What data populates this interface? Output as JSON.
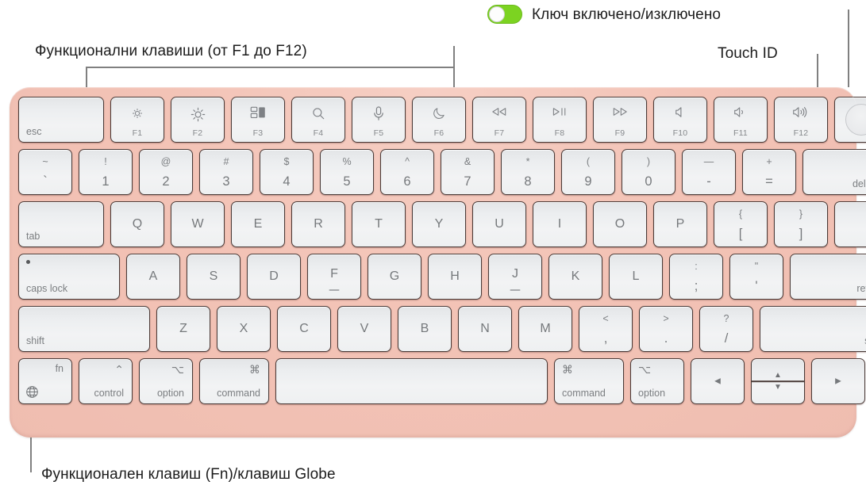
{
  "document": {
    "subject": "Magic Keyboard with Touch ID diagram",
    "language": "bg"
  },
  "callouts": {
    "function_keys": "Функционални клавиши (от F1 до F12)",
    "power_toggle": "Ключ включено/изключено",
    "touch_id": "Touch ID",
    "fn_globe": "Функционален клавиш (Fn)/клавиш Globe"
  },
  "toggle": {
    "state": "on",
    "track_color": "#7cd321",
    "knob_color": "#fdfdfd"
  },
  "colors": {
    "keyboard_body": "#f1c0b3",
    "key_face": "#eef0f1",
    "key_border": "#4a3b38",
    "key_text": "#76797c",
    "leader_line": "#808080",
    "label_text": "#1c1c1c"
  },
  "keyboard": {
    "rows": [
      {
        "name": "function-row",
        "keys": [
          {
            "name": "esc",
            "style": "corner-label",
            "label": "esc"
          },
          {
            "name": "f1",
            "style": "fn",
            "icon": "brightness-down-icon",
            "fkey": "F1"
          },
          {
            "name": "f2",
            "style": "fn",
            "icon": "brightness-up-icon",
            "fkey": "F2"
          },
          {
            "name": "f3",
            "style": "fn",
            "icon": "mission-control-icon",
            "fkey": "F3"
          },
          {
            "name": "f4",
            "style": "fn",
            "icon": "spotlight-search-icon",
            "fkey": "F4"
          },
          {
            "name": "f5",
            "style": "fn",
            "icon": "dictation-mic-icon",
            "fkey": "F5"
          },
          {
            "name": "f6",
            "style": "fn",
            "icon": "do-not-disturb-moon-icon",
            "fkey": "F6"
          },
          {
            "name": "f7",
            "style": "fn",
            "icon": "rewind-icon",
            "fkey": "F7"
          },
          {
            "name": "f8",
            "style": "fn",
            "icon": "play-pause-icon",
            "fkey": "F8"
          },
          {
            "name": "f9",
            "style": "fn",
            "icon": "fast-forward-icon",
            "fkey": "F9"
          },
          {
            "name": "f10",
            "style": "fn",
            "icon": "volume-mute-icon",
            "fkey": "F10"
          },
          {
            "name": "f11",
            "style": "fn",
            "icon": "volume-down-icon",
            "fkey": "F11"
          },
          {
            "name": "f12",
            "style": "fn",
            "icon": "volume-up-icon",
            "fkey": "F12"
          },
          {
            "name": "touch-id",
            "style": "touchid",
            "icon": "touch-id-icon"
          }
        ]
      },
      {
        "name": "number-row",
        "keys": [
          {
            "name": "backtick",
            "style": "dual",
            "upper": "~",
            "lower": "`"
          },
          {
            "name": "digit-1",
            "style": "dual",
            "upper": "!",
            "lower": "1"
          },
          {
            "name": "digit-2",
            "style": "dual",
            "upper": "@",
            "lower": "2"
          },
          {
            "name": "digit-3",
            "style": "dual",
            "upper": "#",
            "lower": "3"
          },
          {
            "name": "digit-4",
            "style": "dual",
            "upper": "$",
            "lower": "4"
          },
          {
            "name": "digit-5",
            "style": "dual",
            "upper": "%",
            "lower": "5"
          },
          {
            "name": "digit-6",
            "style": "dual",
            "upper": "^",
            "lower": "6"
          },
          {
            "name": "digit-7",
            "style": "dual",
            "upper": "&",
            "lower": "7"
          },
          {
            "name": "digit-8",
            "style": "dual",
            "upper": "*",
            "lower": "8"
          },
          {
            "name": "digit-9",
            "style": "dual",
            "upper": "(",
            "lower": "9"
          },
          {
            "name": "digit-0",
            "style": "dual",
            "upper": ")",
            "lower": "0"
          },
          {
            "name": "minus",
            "style": "dual",
            "upper": "—",
            "lower": "-"
          },
          {
            "name": "equals",
            "style": "dual",
            "upper": "+",
            "lower": "="
          },
          {
            "name": "delete",
            "style": "corner-label-right",
            "label": "delete"
          }
        ]
      },
      {
        "name": "qwerty-row",
        "keys": [
          {
            "name": "tab",
            "style": "corner-label",
            "label": "tab"
          },
          {
            "name": "key-q",
            "style": "letter",
            "label": "Q"
          },
          {
            "name": "key-w",
            "style": "letter",
            "label": "W"
          },
          {
            "name": "key-e",
            "style": "letter",
            "label": "E"
          },
          {
            "name": "key-r",
            "style": "letter",
            "label": "R"
          },
          {
            "name": "key-t",
            "style": "letter",
            "label": "T"
          },
          {
            "name": "key-y",
            "style": "letter",
            "label": "Y"
          },
          {
            "name": "key-u",
            "style": "letter",
            "label": "U"
          },
          {
            "name": "key-i",
            "style": "letter",
            "label": "I"
          },
          {
            "name": "key-o",
            "style": "letter",
            "label": "O"
          },
          {
            "name": "key-p",
            "style": "letter",
            "label": "P"
          },
          {
            "name": "bracket-left",
            "style": "dual",
            "upper": "{",
            "lower": "["
          },
          {
            "name": "bracket-right",
            "style": "dual",
            "upper": "}",
            "lower": "]"
          },
          {
            "name": "backslash",
            "style": "dual",
            "upper": "|",
            "lower": "\\"
          }
        ]
      },
      {
        "name": "home-row",
        "keys": [
          {
            "name": "caps-lock",
            "style": "capslock",
            "label": "caps lock"
          },
          {
            "name": "key-a",
            "style": "letter",
            "label": "A"
          },
          {
            "name": "key-s",
            "style": "letter",
            "label": "S"
          },
          {
            "name": "key-d",
            "style": "letter",
            "label": "D"
          },
          {
            "name": "key-f",
            "style": "letter",
            "label": "F",
            "homing": true
          },
          {
            "name": "key-g",
            "style": "letter",
            "label": "G"
          },
          {
            "name": "key-h",
            "style": "letter",
            "label": "H"
          },
          {
            "name": "key-j",
            "style": "letter",
            "label": "J",
            "homing": true
          },
          {
            "name": "key-k",
            "style": "letter",
            "label": "K"
          },
          {
            "name": "key-l",
            "style": "letter",
            "label": "L"
          },
          {
            "name": "semicolon",
            "style": "dual",
            "upper": ":",
            "lower": ";"
          },
          {
            "name": "quote",
            "style": "dual",
            "upper": "\"",
            "lower": "'"
          },
          {
            "name": "return",
            "style": "corner-label-right",
            "label": "return"
          }
        ]
      },
      {
        "name": "shift-row",
        "keys": [
          {
            "name": "shift-left",
            "style": "corner-label",
            "label": "shift"
          },
          {
            "name": "key-z",
            "style": "letter",
            "label": "Z"
          },
          {
            "name": "key-x",
            "style": "letter",
            "label": "X"
          },
          {
            "name": "key-c",
            "style": "letter",
            "label": "C"
          },
          {
            "name": "key-v",
            "style": "letter",
            "label": "V"
          },
          {
            "name": "key-b",
            "style": "letter",
            "label": "B"
          },
          {
            "name": "key-n",
            "style": "letter",
            "label": "N"
          },
          {
            "name": "key-m",
            "style": "letter",
            "label": "M"
          },
          {
            "name": "comma",
            "style": "dual",
            "upper": "<",
            "lower": ","
          },
          {
            "name": "period",
            "style": "dual",
            "upper": ">",
            "lower": "."
          },
          {
            "name": "slash",
            "style": "dual",
            "upper": "?",
            "lower": "/"
          },
          {
            "name": "shift-right",
            "style": "corner-label-right",
            "label": "shift"
          }
        ]
      },
      {
        "name": "bottom-row",
        "keys": [
          {
            "name": "fn-globe",
            "style": "fnglobe",
            "label": "fn",
            "icon": "globe-icon"
          },
          {
            "name": "control",
            "style": "mod-right",
            "symbol": "⌃",
            "label": "control"
          },
          {
            "name": "option-left",
            "style": "mod-right",
            "symbol": "⌥",
            "label": "option"
          },
          {
            "name": "command-left",
            "style": "mod-right",
            "symbol": "⌘",
            "label": "command"
          },
          {
            "name": "space",
            "style": "blank"
          },
          {
            "name": "command-right",
            "style": "mod-left",
            "symbol": "⌘",
            "label": "command"
          },
          {
            "name": "option-right",
            "style": "mod-left",
            "symbol": "⌥",
            "label": "option"
          },
          {
            "name": "arrow-left",
            "style": "arrow",
            "icon": "arrow-left-icon",
            "glyph": "◀"
          },
          {
            "name": "arrow-updown",
            "style": "arrow-stack",
            "up_icon": "arrow-up-icon",
            "down_icon": "arrow-down-icon",
            "up_glyph": "▲",
            "down_glyph": "▼"
          },
          {
            "name": "arrow-right",
            "style": "arrow",
            "icon": "arrow-right-icon",
            "glyph": "▶"
          }
        ]
      }
    ]
  }
}
